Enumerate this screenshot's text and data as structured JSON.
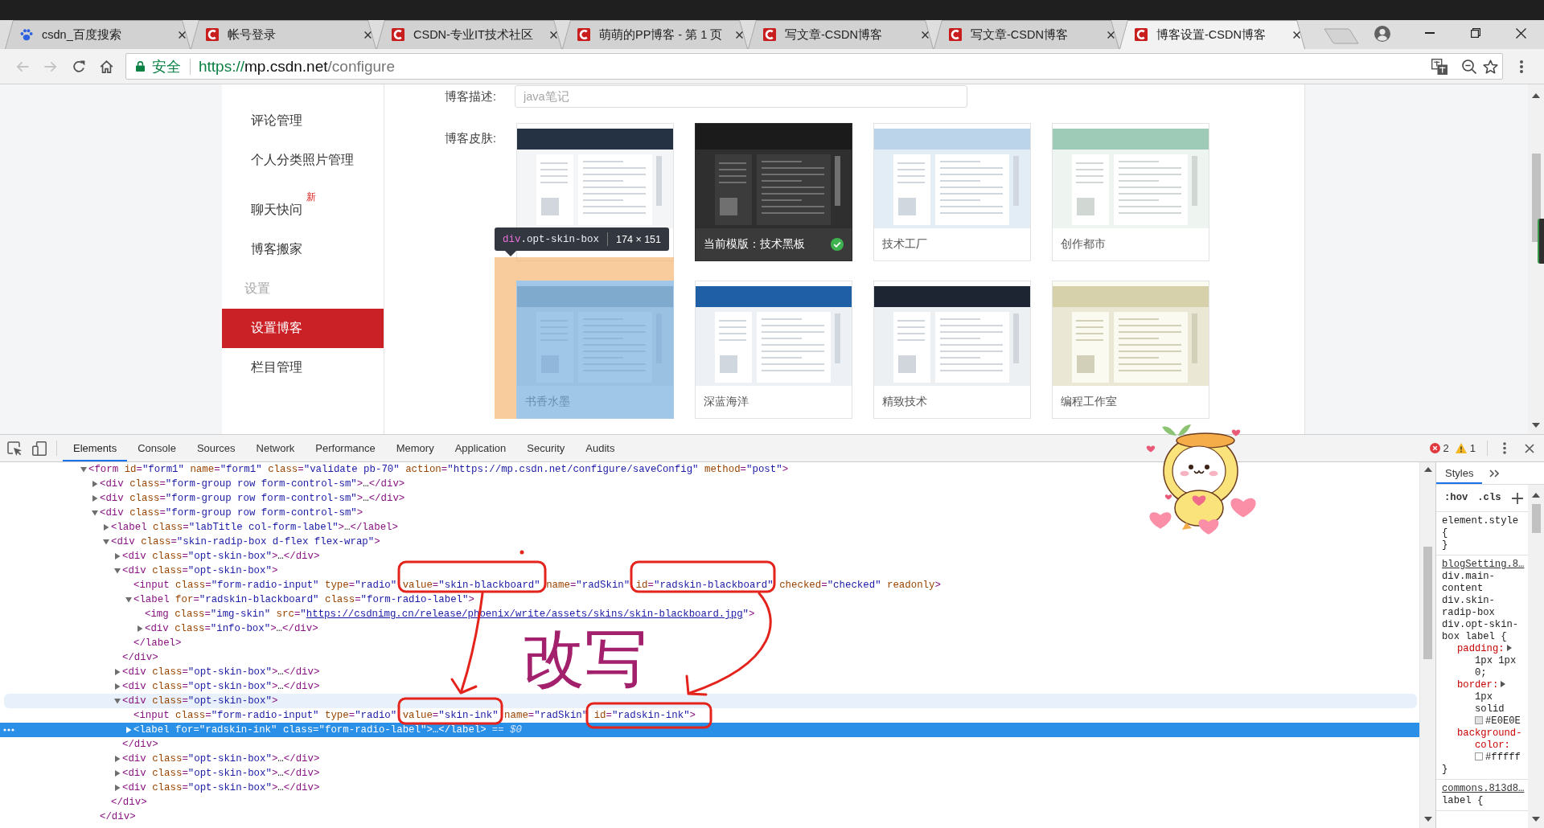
{
  "browser": {
    "tabs": [
      {
        "kind": "paw",
        "title": "csdn_百度搜索",
        "selected": false
      },
      {
        "kind": "c-logo",
        "title": "帐号登录",
        "selected": false
      },
      {
        "kind": "c-logo",
        "title": "CSDN-专业IT技术社区",
        "selected": false
      },
      {
        "kind": "c-logo",
        "title": "萌萌的PP博客 - 第 1 页",
        "selected": false
      },
      {
        "kind": "c-logo",
        "title": "写文章-CSDN博客",
        "selected": false
      },
      {
        "kind": "c-logo",
        "title": "写文章-CSDN博客",
        "selected": false
      },
      {
        "kind": "c-logo",
        "title": "博客设置-CSDN博客",
        "selected": true
      }
    ],
    "nav": [
      {
        "kind": "back",
        "disabled": true
      },
      {
        "kind": "forward",
        "disabled": true
      },
      {
        "kind": "reload",
        "disabled": false
      },
      {
        "kind": "home",
        "disabled": false
      }
    ],
    "address": {
      "security": "安全",
      "scheme": "https://",
      "host": "mp.csdn.net",
      "path": "/configure"
    }
  },
  "sidebar": {
    "items": [
      {
        "kind": "item",
        "label": "评论管理",
        "selected": false
      },
      {
        "kind": "item",
        "label": "个人分类照片管理",
        "selected": false
      },
      {
        "kind": "item",
        "label": "聊天快问",
        "badge": "新",
        "selected": false
      },
      {
        "kind": "item",
        "label": "博客搬家",
        "selected": false
      },
      {
        "kind": "heading",
        "label": "设置",
        "selected": false
      },
      {
        "kind": "item",
        "label": "设置博客",
        "selected": true
      },
      {
        "kind": "item",
        "label": "栏目管理",
        "selected": false
      }
    ]
  },
  "form": {
    "description": {
      "label": "博客描述:",
      "placeholder": "java笔记"
    },
    "skins": {
      "label": "博客皮肤:",
      "options": [
        {
          "kind": "classic",
          "selected": false,
          "highlighted": false
        },
        {
          "kind": "blackboard",
          "caption": "当前模版：技术黑板",
          "selected": true,
          "highlighted": false
        },
        {
          "kind": "factory",
          "caption": "技术工厂",
          "selected": false,
          "highlighted": false
        },
        {
          "kind": "city",
          "caption": "创作都市",
          "selected": false,
          "highlighted": false
        },
        {
          "kind": "ink",
          "caption": "书香水墨",
          "selected": false,
          "highlighted": true
        },
        {
          "kind": "ocean",
          "caption": "深蓝海洋",
          "selected": false,
          "highlighted": false
        },
        {
          "kind": "tech",
          "caption": "精致技术",
          "selected": false,
          "highlighted": false
        },
        {
          "kind": "studio",
          "caption": "编程工作室",
          "selected": false,
          "highlighted": false
        }
      ],
      "inspect_tooltip": {
        "tag": "div",
        "class_name": ".opt-skin-box",
        "size": "174 × 151"
      }
    }
  },
  "devtools": {
    "tabs": [
      {
        "label": "Elements",
        "selected": true
      },
      {
        "label": "Console",
        "selected": false
      },
      {
        "label": "Sources",
        "selected": false
      },
      {
        "label": "Network",
        "selected": false
      },
      {
        "label": "Performance",
        "selected": false
      },
      {
        "label": "Memory",
        "selected": false
      },
      {
        "label": "Application",
        "selected": false
      },
      {
        "label": "Security",
        "selected": false
      },
      {
        "label": "Audits",
        "selected": false
      }
    ],
    "counters": [
      {
        "kind": "error",
        "count": "2"
      },
      {
        "kind": "warning",
        "count": "1"
      }
    ],
    "dom": [
      {
        "kind": "element",
        "text": "<form id=\"form1\" name=\"form1\" class=\"validate pb-70\" action=\"https://mp.csdn.net/configure/saveConfig\" method=\"post\">",
        "expanded": true,
        "selected": false,
        "hovered": false,
        "children": [
          {
            "kind": "element",
            "text": "<div class=\"form-group row form-control-sm\">…</div>",
            "expanded": false,
            "selected": false,
            "hovered": false
          },
          {
            "kind": "element",
            "text": "<div class=\"form-group row form-control-sm\">…</div>",
            "expanded": false,
            "selected": false,
            "hovered": false
          },
          {
            "kind": "element",
            "text": "<div class=\"form-group row form-control-sm\">",
            "expanded": true,
            "selected": false,
            "hovered": false,
            "closing": "</div>",
            "children": [
              {
                "kind": "element",
                "text": "<label class=\"labTitle col-form-label\">…</label>",
                "expanded": false,
                "selected": false,
                "hovered": false
              },
              {
                "kind": "element",
                "text": "<div class=\"skin-radip-box d-flex flex-wrap\">",
                "expanded": true,
                "selected": false,
                "hovered": false,
                "closing": "</div>",
                "children": [
                  {
                    "kind": "element",
                    "text": "<div class=\"opt-skin-box\">…</div>",
                    "expanded": false,
                    "selected": false,
                    "hovered": false
                  },
                  {
                    "kind": "element",
                    "text": "<div class=\"opt-skin-box\">",
                    "expanded": true,
                    "selected": false,
                    "hovered": false,
                    "closing": "</div>",
                    "children": [
                      {
                        "kind": "leaf",
                        "text": "<input class=\"form-radio-input\" type=\"radio\" value=\"skin-blackboard\" name=\"radSkin\" id=\"radskin-blackboard\" checked=\"checked\" readonly>",
                        "selected": false,
                        "hovered": false
                      },
                      {
                        "kind": "element",
                        "text": "<label for=\"radskin-blackboard\" class=\"form-radio-label\">",
                        "expanded": true,
                        "selected": false,
                        "hovered": false,
                        "closing": "</label>",
                        "children": [
                          {
                            "kind": "leaf",
                            "text": "<img class=\"img-skin\" src=\"",
                            "link": "https://csdnimg.cn/release/phoenix/write/assets/skins/skin-blackboard.jpg",
                            "after": "\">",
                            "selected": false,
                            "hovered": false
                          },
                          {
                            "kind": "element",
                            "text": "<div class=\"info-box\">…</div>",
                            "expanded": false,
                            "selected": false,
                            "hovered": false
                          }
                        ]
                      }
                    ]
                  },
                  {
                    "kind": "element",
                    "text": "<div class=\"opt-skin-box\">…</div>",
                    "expanded": false,
                    "selected": false,
                    "hovered": false
                  },
                  {
                    "kind": "element",
                    "text": "<div class=\"opt-skin-box\">…</div>",
                    "expanded": false,
                    "selected": false,
                    "hovered": false
                  },
                  {
                    "kind": "element",
                    "text": "<div class=\"opt-skin-box\">",
                    "expanded": true,
                    "selected": false,
                    "hovered": true,
                    "closing": "</div>",
                    "children": [
                      {
                        "kind": "leaf",
                        "text": "<input class=\"form-radio-input\" type=\"radio\" value=\"skin-ink\" name=\"radSkin\" id=\"radskin-ink\">",
                        "selected": false,
                        "hovered": false
                      },
                      {
                        "kind": "element",
                        "text": "<label for=\"radskin-ink\" class=\"form-radio-label\">…</label>",
                        "marker": "== $0",
                        "expanded": false,
                        "selected": true,
                        "hovered": false
                      }
                    ]
                  },
                  {
                    "kind": "element",
                    "text": "<div class=\"opt-skin-box\">…</div>",
                    "expanded": false,
                    "selected": false,
                    "hovered": false
                  },
                  {
                    "kind": "element",
                    "text": "<div class=\"opt-skin-box\">…</div>",
                    "expanded": false,
                    "selected": false,
                    "hovered": false
                  },
                  {
                    "kind": "element",
                    "text": "<div class=\"opt-skin-box\">…</div>",
                    "expanded": false,
                    "selected": false,
                    "hovered": false
                  }
                ]
              }
            ]
          }
        ]
      }
    ],
    "styles": {
      "tabs": [
        {
          "label": "Styles",
          "selected": true
        }
      ],
      "toolbar": [
        ":hov",
        ".cls"
      ],
      "rules": [
        {
          "selector": "element.style {",
          "closing": "}"
        },
        {
          "source": "blogSetting.8…",
          "selector": "div.main-content div.skin-radip-box div.opt-skin-box label {",
          "properties": [
            {
              "kind": "shorthand",
              "name": "padding:",
              "value": "1px 1px 0;"
            },
            {
              "kind": "shorthand",
              "name": "border:",
              "value": "1px solid",
              "swatch": {
                "color": "#e0e0e0",
                "text": "#E0E0E"
              }
            },
            {
              "kind": "plain",
              "name": "background-color:",
              "swatch": {
                "color": "#ffffff",
                "text": "#fffff"
              }
            }
          ],
          "closing": "}"
        },
        {
          "source": "commons.813d8…",
          "selector": "label {"
        }
      ]
    }
  },
  "annotation": {
    "text": "改写"
  }
}
